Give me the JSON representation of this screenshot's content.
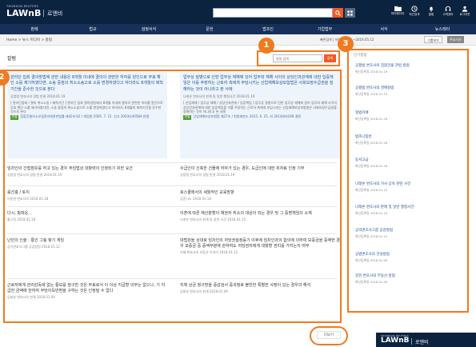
{
  "header": {
    "brand_super": "THOMSON REUTERS",
    "brand": "LAWnB",
    "brand_sub": "로앤비",
    "search_value": "",
    "utilities": [
      {
        "label": "마이페이지",
        "icon": "folder-icon"
      },
      {
        "label": "최근검색",
        "icon": "history-icon"
      },
      {
        "label": "알림",
        "icon": "bell-icon"
      },
      {
        "label": "고객센터",
        "icon": "headset-icon"
      },
      {
        "label": "로그아웃",
        "icon": "user-icon"
      }
    ]
  },
  "nav": {
    "items": [
      "판례",
      "법규",
      "검정서식",
      "문헌",
      "법조인",
      "기업법무",
      "서식",
      "뉴스레터"
    ]
  },
  "breadcrumb": "Home > 뉴스 미디어 > 칼럼",
  "breadcrumb_right": "빠른검색 | 저장 | 인쇄 | ~2016.05.12",
  "chips": {
    "folder": "그룹보기",
    "top": "주요기사"
  },
  "page_title": "칼럼",
  "inline_search": {
    "placeholder": "칼럼 검색",
    "button": "검색"
  },
  "featured": [
    {
      "title": "관리단 집회 결의방법에 관한 내용은 8개월 이내에 결의의 관련한 하자를 원인으로 무효 확인 소를 제기하였다면, 소송 중점의 취소소송으로 소를 변경하였다고 하더라도 8개월의 제척기간을 준수한 것으로 본다",
      "meta": "공법법 변호사의 경법 판결 2018.01.19",
      "body": "[ 관리단집회 / 결의 취소소송 / 제척기간 ] 관리단 집회 결의방법에서 8개월 이내에 결의의 관련한 하자를 원인으로 무효 확인 소를 제기하였다면, 소송 중점의 취소소송으로 소를 변경하였다고 하더라도 8개월의 제척기간을 준수한 것으로 본다",
      "tag": "판결",
      "refs": "집합건물의소유및관리에관한법률 제42조의2 / 대법원 2005. 7. 21. 선고 2003다40584 판결"
    },
    {
      "title": "업무상 질병으로 인한 업무상 재해에 있어 업무와 재해 사이의 상당인과관계에 대한 입증책임은 이를 주장하는 근로자 측에게 부담시키는 산업재해보상보험법은 사회보장수급권을 침해하는 것이 아니라고 본 사례",
      "meta": "나래온 변호사의 판례 및 일반 행정사건 2018.01.19",
      "body": "[ 산업재해 / 업무상 재해 / 상당인과관계 / 입증책임 ] 업무상 질병으로 인한 업무상 재해에 있어 업무와 재해 사이의 상당인과관계에 대한 입증책임을 이를 주장하는 근로자 측에게 부담시키는 산업재해보상보험법은 사회보장수급권을 침해하는 것이 아니라고 본 사례",
      "tag": "판결",
      "refs": "산업재해보상보험법 제37조 / 헌법재판소 2015. 6. 25. 자 2014헌바269 결정"
    }
  ],
  "list": [
    {
      "title": "임차인의 간접점유를 하고 있는 경우 주임법상 대항력이 인정되기 위한 요건",
      "meta": "공법법 변호사의 경법 판결 2018.01.19"
    },
    {
      "title": "수급인이 신축한 건물에 하자가 있는 경우, 도급인에 대한 위자료 인정 기부",
      "meta": "공법법 변호사의 경법 판결 2018.01.19"
    },
    {
      "title": "롤선충 / 토지",
      "meta": "이동현 변호사의 2018.01.18"
    },
    {
      "title": "로스쿨에서의 세월적인 교육방향",
      "meta": "김준나노 2018.01.18"
    },
    {
      "title": "다시, 핑파운...",
      "meta": "황규정 2018.01.18"
    },
    {
      "title": "이혼에 따른 재산분할이 채권자 취소의 대상이 되는 경우 및 그 증명책임의 소재",
      "meta": "나래온 변호사의 판례 및 일반 사건 2018.01.15"
    },
    {
      "title": "난민의 인술 : 통인 그림 찾기 게임",
      "meta": "공익변호사그룹 공감칼럼 2018.01.12"
    },
    {
      "title": "대법원을 상대로 임차인의 저당권설정등기 이후에 임차인과의 합의에 의하여 보증금을 증액한 경우 보증금 중 증액부분에 관하여도 저당권자에게 대항할 권리를 가지는지 여부",
      "meta": "이혜 변호사의 부동산 이야기 2018.01.12"
    },
    {
      "title": "근로자에게 관리감독에 없는 통보를 청구한 것은 무효로서 이 이상 지급할 의무는 없으나, 기 지급한 금액에 한하여 부당이득반환을 구하는 것은 인정될 수 없다",
      "meta": "김태호 변호사의 판례 2018.01.09"
    },
    {
      "title": "지체 상금 청구방을 증감검서 증과청로 볼만한 특별한 사정이 있는 경우의 해석",
      "meta": "김태호 변호사의 판례 2018.01.09"
    }
  ],
  "more_label": "더보기",
  "sidebar": {
    "head": "인기칼럼",
    "items": [
      {
        "title": "공평법 변호사의 집합건물 관련 칼럼",
        "meta": "최신등록일 2018.01.19"
      },
      {
        "title": "공평법 변호사의 경매칼럼",
        "meta": "최신등록일 2018.01.19"
      },
      {
        "title": "형법카페",
        "meta": "최신등록일 2018.01.16"
      },
      {
        "title": "법조나침반",
        "meta": "최신등록일 2018.01.16"
      },
      {
        "title": "동서고금",
        "meta": "최신등록일 2018.01.16"
      },
      {
        "title": "나래온 변호사의 가사 상속 관련 사건",
        "meta": "최신등록일 2018.01.15"
      },
      {
        "title": "나래온 변호사의 판례 및 일반 행정사건",
        "meta": "최신등록일 2018.01.15"
      },
      {
        "title": "공익변호사그룹 공감칼럼",
        "meta": "최신등록일 2018.01.12"
      },
      {
        "title": "공법변호사의 건설칼럼",
        "meta": "최신등록일 2018.01.09"
      },
      {
        "title": "김헌 변호사의 부동산 칼럼",
        "meta": "최신등록일 2018.01.09"
      }
    ]
  },
  "annotations": [
    "1",
    "2",
    "3"
  ],
  "colors": {
    "navy": "#0c2340",
    "nav": "#16305a",
    "accent": "#f15a24",
    "annotation": "#f07a1f",
    "link": "#1a4f92"
  }
}
